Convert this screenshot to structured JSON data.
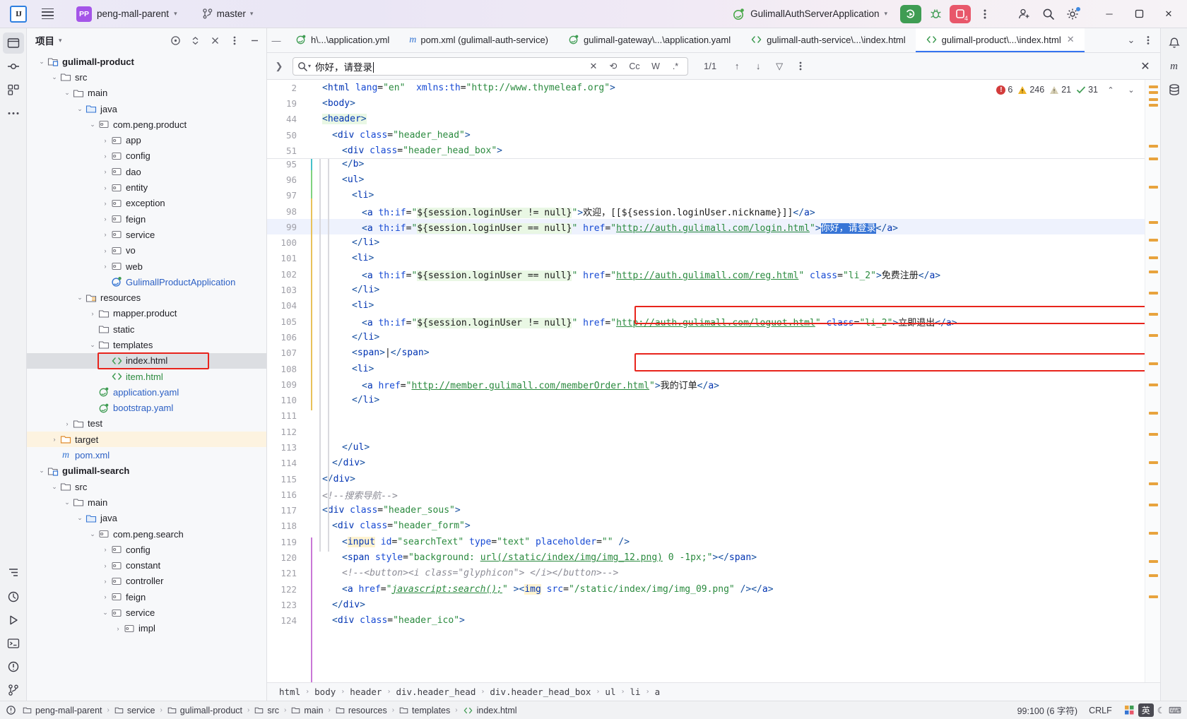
{
  "titlebar": {
    "logo_text": "IJ",
    "project_name": "peng-mall-parent",
    "branch_name": "master",
    "run_config": "GulimallAuthServerApplication",
    "stop_count": "4",
    "icons": [
      "hamburger-icon",
      "project-badge",
      "branch-icon",
      "run-icon",
      "debug-icon",
      "stop-icon",
      "more-icon",
      "add-user-icon",
      "search-icon",
      "settings-icon"
    ],
    "window_min": "─",
    "window_max": "☐",
    "window_close": "✕"
  },
  "project_panel": {
    "title": "项目",
    "tree": [
      {
        "depth": 1,
        "arrow": "down",
        "icon": "module",
        "label": "gulimall-product",
        "style": "bold"
      },
      {
        "depth": 2,
        "arrow": "down",
        "icon": "folder",
        "label": "src",
        "style": ""
      },
      {
        "depth": 3,
        "arrow": "down",
        "icon": "folder",
        "label": "main",
        "style": ""
      },
      {
        "depth": 4,
        "arrow": "down",
        "icon": "folder-src",
        "label": "java",
        "style": ""
      },
      {
        "depth": 5,
        "arrow": "down",
        "icon": "package",
        "label": "com.peng.product",
        "style": ""
      },
      {
        "depth": 6,
        "arrow": "right",
        "icon": "package",
        "label": "app",
        "style": ""
      },
      {
        "depth": 6,
        "arrow": "right",
        "icon": "package",
        "label": "config",
        "style": ""
      },
      {
        "depth": 6,
        "arrow": "right",
        "icon": "package",
        "label": "dao",
        "style": ""
      },
      {
        "depth": 6,
        "arrow": "right",
        "icon": "package",
        "label": "entity",
        "style": ""
      },
      {
        "depth": 6,
        "arrow": "right",
        "icon": "package",
        "label": "exception",
        "style": ""
      },
      {
        "depth": 6,
        "arrow": "right",
        "icon": "package",
        "label": "feign",
        "style": ""
      },
      {
        "depth": 6,
        "arrow": "right",
        "icon": "package",
        "label": "service",
        "style": ""
      },
      {
        "depth": 6,
        "arrow": "right",
        "icon": "package",
        "label": "vo",
        "style": ""
      },
      {
        "depth": 6,
        "arrow": "right",
        "icon": "package",
        "label": "web",
        "style": ""
      },
      {
        "depth": 6,
        "arrow": "none",
        "icon": "spring-class",
        "label": "GulimallProductApplication",
        "style": "blue"
      },
      {
        "depth": 4,
        "arrow": "down",
        "icon": "folder-res",
        "label": "resources",
        "style": ""
      },
      {
        "depth": 5,
        "arrow": "right",
        "icon": "folder",
        "label": "mapper.product",
        "style": ""
      },
      {
        "depth": 5,
        "arrow": "none",
        "icon": "folder",
        "label": "static",
        "style": ""
      },
      {
        "depth": 5,
        "arrow": "down",
        "icon": "folder",
        "label": "templates",
        "style": ""
      },
      {
        "depth": 6,
        "arrow": "none",
        "icon": "html",
        "label": "index.html",
        "style": "selected"
      },
      {
        "depth": 6,
        "arrow": "none",
        "icon": "html",
        "label": "item.html",
        "style": "green"
      },
      {
        "depth": 5,
        "arrow": "none",
        "icon": "yaml",
        "label": "application.yaml",
        "style": "blue"
      },
      {
        "depth": 5,
        "arrow": "none",
        "icon": "yaml",
        "label": "bootstrap.yaml",
        "style": "blue"
      },
      {
        "depth": 3,
        "arrow": "right",
        "icon": "folder",
        "label": "test",
        "style": ""
      },
      {
        "depth": 2,
        "arrow": "right",
        "icon": "folder-target",
        "label": "target",
        "style": "target"
      },
      {
        "depth": 2,
        "arrow": "none",
        "icon": "maven",
        "label": "pom.xml",
        "style": "blue"
      },
      {
        "depth": 1,
        "arrow": "down",
        "icon": "module",
        "label": "gulimall-search",
        "style": "bold"
      },
      {
        "depth": 2,
        "arrow": "down",
        "icon": "folder",
        "label": "src",
        "style": ""
      },
      {
        "depth": 3,
        "arrow": "down",
        "icon": "folder",
        "label": "main",
        "style": ""
      },
      {
        "depth": 4,
        "arrow": "down",
        "icon": "folder-src",
        "label": "java",
        "style": ""
      },
      {
        "depth": 5,
        "arrow": "down",
        "icon": "package",
        "label": "com.peng.search",
        "style": ""
      },
      {
        "depth": 6,
        "arrow": "right",
        "icon": "package",
        "label": "config",
        "style": ""
      },
      {
        "depth": 6,
        "arrow": "right",
        "icon": "package",
        "label": "constant",
        "style": ""
      },
      {
        "depth": 6,
        "arrow": "right",
        "icon": "package",
        "label": "controller",
        "style": ""
      },
      {
        "depth": 6,
        "arrow": "right",
        "icon": "package",
        "label": "feign",
        "style": ""
      },
      {
        "depth": 6,
        "arrow": "down",
        "icon": "package",
        "label": "service",
        "style": ""
      },
      {
        "depth": 7,
        "arrow": "right",
        "icon": "package",
        "label": "impl",
        "style": ""
      }
    ]
  },
  "editor": {
    "tabs": [
      {
        "label": "h\\...\\application.yml",
        "icon": "yaml-icon",
        "active": false
      },
      {
        "label": "pom.xml (gulimall-auth-service)",
        "icon": "maven-icon",
        "active": false
      },
      {
        "label": "gulimall-gateway\\...\\application.yaml",
        "icon": "yaml-icon",
        "active": false
      },
      {
        "label": "gulimall-auth-service\\...\\index.html",
        "icon": "html-icon",
        "active": false
      },
      {
        "label": "gulimall-product\\...\\index.html",
        "icon": "html-icon",
        "active": true
      }
    ],
    "find": {
      "query": "你好，请登录",
      "match_count": "1/1",
      "options": [
        "Cc",
        "W",
        ".*"
      ],
      "icons": [
        "search-dropdown-icon",
        "clear-icon",
        "regex-replace-icon",
        "prev-match-icon",
        "next-match-icon",
        "filter-icon",
        "more-options-icon",
        "close-find-icon"
      ]
    },
    "inspections": {
      "errors": "6",
      "warnings": "246",
      "weak_warnings": "21",
      "ok": "31"
    },
    "sticky_lines": [
      {
        "num": "2",
        "indent": 0,
        "html": "<span class='tag'>&lt;</span><span class='tagname'>html</span> <span class='attr'>lang</span>=<span class='str'>\"en\"</span>  <span class='attr'>xmlns:th</span>=<span class='str'>\"http://www.thymeleaf.org\"</span><span class='tag'>&gt;</span>"
      },
      {
        "num": "19",
        "indent": 0,
        "html": "<span class='tag'>&lt;</span><span class='tagname'>body</span><span class='tag'>&gt;</span>"
      },
      {
        "num": "44",
        "indent": 0,
        "html": "<span class='el'><span class='tag'>&lt;</span><span class='tagname'>header</span><span class='tag'>&gt;</span></span>"
      },
      {
        "num": "50",
        "indent": 1,
        "html": "<span class='tag'>&lt;</span><span class='tagname'>div</span> <span class='attr'>class</span>=<span class='str'>\"header_head\"</span><span class='tag'>&gt;</span>"
      },
      {
        "num": "51",
        "indent": 2,
        "html": "<span class='tag'>&lt;</span><span class='tagname'>div</span> <span class='attr'>class</span>=<span class='str'>\"header_head_box\"</span><span class='tag'>&gt;</span>"
      }
    ],
    "code_lines": [
      {
        "num": "95",
        "indent": 2,
        "html": "<span class='tag'>&lt;/</span><span class='tagname'>b</span><span class='tag'>&gt;</span>"
      },
      {
        "num": "96",
        "indent": 2,
        "html": "<span class='tag'>&lt;</span><span class='tagname'>ul</span><span class='tag'>&gt;</span>"
      },
      {
        "num": "97",
        "indent": 3,
        "html": "<span class='tag'>&lt;</span><span class='tagname'>li</span><span class='tag'>&gt;</span>"
      },
      {
        "num": "98",
        "indent": 4,
        "html": "<span class='tag'>&lt;</span><span class='tagname'>a</span> <span class='attr'>th:if</span>=<span class='str'>\"</span><span class='el'>${session.loginUser != null}</span><span class='str'>\"</span><span class='tag'>&gt;</span><span class='txt'>欢迎，[[${session.loginUser.nickname}]]</span><span class='tag'>&lt;/</span><span class='tagname'>a</span><span class='tag'>&gt;</span>"
      },
      {
        "num": "99",
        "indent": 4,
        "hl": true,
        "html": "<span class='tag'>&lt;</span><span class='tagname'>a</span> <span class='attr'>th:if</span>=<span class='str'>\"</span><span class='el'>${session.loginUser == null}</span><span class='str'>\"</span> <span class='attr'>href</span>=<span class='str'>\"</span><span class='url'>http://auth.gulimall.com/login.html</span><span class='str'>\"</span><span class='tag'>&gt;</span><span class='sel'>你好，请登录</span><span class='tag'>&lt;/</span><span class='tagname'>a</span><span class='tag'>&gt;</span>"
      },
      {
        "num": "100",
        "indent": 3,
        "html": "<span class='tag'>&lt;/</span><span class='tagname'>li</span><span class='tag'>&gt;</span>"
      },
      {
        "num": "101",
        "indent": 3,
        "html": "<span class='tag'>&lt;</span><span class='tagname'>li</span><span class='tag'>&gt;</span>"
      },
      {
        "num": "102",
        "indent": 4,
        "html": "<span class='tag'>&lt;</span><span class='tagname'>a</span> <span class='attr'>th:if</span>=<span class='str'>\"</span><span class='el'>${session.loginUser == null}</span><span class='str'>\"</span> <span class='attr'>href</span>=<span class='str'>\"</span><span class='url'>http://auth.gulimall.com/reg.html</span><span class='str'>\"</span> <span class='attr'>class</span>=<span class='str'>\"li_2\"</span><span class='tag'>&gt;</span><span class='txt'>免费注册</span><span class='tag'>&lt;/</span><span class='tagname'>a</span><span class='tag'>&gt;</span>"
      },
      {
        "num": "103",
        "indent": 3,
        "html": "<span class='tag'>&lt;/</span><span class='tagname'>li</span><span class='tag'>&gt;</span>"
      },
      {
        "num": "104",
        "indent": 3,
        "html": "<span class='tag'>&lt;</span><span class='tagname'>li</span><span class='tag'>&gt;</span>"
      },
      {
        "num": "105",
        "indent": 4,
        "html": "<span class='tag'>&lt;</span><span class='tagname'>a</span> <span class='attr'>th:if</span>=<span class='str'>\"</span><span class='el'>${session.loginUser != null}</span><span class='str'>\"</span> <span class='attr'>href</span>=<span class='str'>\"</span><span class='url'>http://auth.gulimall.com/loguot.html</span><span class='str'>\"</span> <span class='attr'>class</span>=<span class='str'>\"li_2\"</span><span class='tag'>&gt;</span><span class='txt'>立即退出</span><span class='tag'>&lt;/</span><span class='tagname'>a</span><span class='tag'>&gt;</span>"
      },
      {
        "num": "106",
        "indent": 3,
        "html": "<span class='tag'>&lt;/</span><span class='tagname'>li</span><span class='tag'>&gt;</span>"
      },
      {
        "num": "107",
        "indent": 3,
        "html": "<span class='tag'>&lt;</span><span class='tagname'>span</span><span class='tag'>&gt;</span><span class='txt'>|</span><span class='tag'>&lt;/</span><span class='tagname'>span</span><span class='tag'>&gt;</span>"
      },
      {
        "num": "108",
        "indent": 3,
        "html": "<span class='tag'>&lt;</span><span class='tagname'>li</span><span class='tag'>&gt;</span>"
      },
      {
        "num": "109",
        "indent": 4,
        "html": "<span class='tag'>&lt;</span><span class='tagname'>a</span> <span class='attr'>href</span>=<span class='str'>\"</span><span class='url'>http://member.gulimall.com/memberOrder.html</span><span class='str'>\"</span><span class='tag'>&gt;</span><span class='txt'>我的订单</span><span class='tag'>&lt;/</span><span class='tagname'>a</span><span class='tag'>&gt;</span>"
      },
      {
        "num": "110",
        "indent": 3,
        "html": "<span class='tag'>&lt;/</span><span class='tagname'>li</span><span class='tag'>&gt;</span>"
      },
      {
        "num": "111",
        "indent": 0,
        "html": ""
      },
      {
        "num": "112",
        "indent": 0,
        "html": ""
      },
      {
        "num": "113",
        "indent": 2,
        "html": "<span class='tag'>&lt;/</span><span class='tagname'>ul</span><span class='tag'>&gt;</span>"
      },
      {
        "num": "114",
        "indent": 1,
        "html": "<span class='tag'>&lt;/</span><span class='tagname'>div</span><span class='tag'>&gt;</span>"
      },
      {
        "num": "115",
        "indent": 0,
        "html": "<span class='tag'>&lt;/</span><span class='tagname'>div</span><span class='tag'>&gt;</span>"
      },
      {
        "num": "116",
        "indent": 0,
        "html": "<span class='cmt'>&lt;!--搜索导航--&gt;</span>"
      },
      {
        "num": "117",
        "indent": 0,
        "html": "<span class='tag'>&lt;</span><span class='tagname'>div</span> <span class='attr'>class</span>=<span class='str'>\"header_sous\"</span><span class='tag'>&gt;</span>"
      },
      {
        "num": "118",
        "indent": 1,
        "html": "<span class='tag'>&lt;</span><span class='tagname'>div</span> <span class='attr'>class</span>=<span class='str'>\"header_form\"</span><span class='tag'>&gt;</span>"
      },
      {
        "num": "119",
        "indent": 2,
        "html": "<span class='tag'>&lt;</span><span class='tagname' style='background:#fff3d0'>input</span> <span class='attr'>id</span>=<span class='str'>\"searchText\"</span> <span class='attr'>type</span>=<span class='str'>\"text\"</span> <span class='attr'>placeholder</span>=<span class='str'>\"\"</span> <span class='tag'>/&gt;</span>"
      },
      {
        "num": "120",
        "indent": 2,
        "html": "<span class='tag'>&lt;</span><span class='tagname'>span</span> <span class='attr'>style</span>=<span class='str'>\"background: </span><span class='url'>url(/static/index/img/img_12.png)</span><span class='str'> 0 -1px;\"</span><span class='tag'>&gt;</span><span class='tag'>&lt;/</span><span class='tagname'>span</span><span class='tag'>&gt;</span>"
      },
      {
        "num": "121",
        "indent": 2,
        "html": "<span class='cmt'>&lt;!--&lt;button&gt;&lt;i class=\"glyphicon\"&gt; &lt;/i&gt;&lt;/button&gt;--&gt;</span>"
      },
      {
        "num": "122",
        "indent": 2,
        "html": "<span class='tag'>&lt;</span><span class='tagname'>a</span> <span class='attr'>href</span>=<span class='str'>\"</span><span class='jsu'>javascript:search();</span><span class='str'>\"</span> <span class='tag'>&gt;&lt;</span><span class='tagname' style='background:#fff3d0'>img</span> <span class='attr'>src</span>=<span class='str'>\"/static/index/img/img_09.png\"</span> <span class='tag'>/&gt;&lt;/</span><span class='tagname'>a</span><span class='tag'>&gt;</span>"
      },
      {
        "num": "123",
        "indent": 1,
        "html": "<span class='tag'>&lt;/</span><span class='tagname'>div</span><span class='tag'>&gt;</span>"
      },
      {
        "num": "124",
        "indent": 1,
        "html": "<span class='tag'>&lt;</span><span class='tagname'>div</span> <span class='attr'>class</span>=<span class='str'>\"header_ico\"</span><span class='tag'>&gt;</span>"
      }
    ],
    "breadcrumbs": [
      "html",
      "body",
      "header",
      "div.header_head",
      "div.header_head_box",
      "ul",
      "li",
      "a"
    ]
  },
  "statusbar": {
    "crumbs": [
      "peng-mall-parent",
      "service",
      "gulimall-product",
      "src",
      "main",
      "resources",
      "templates",
      "index.html"
    ],
    "caret_position": "99:100 (6 字符)",
    "line_separator": "CRLF",
    "ime_lang": "英"
  }
}
